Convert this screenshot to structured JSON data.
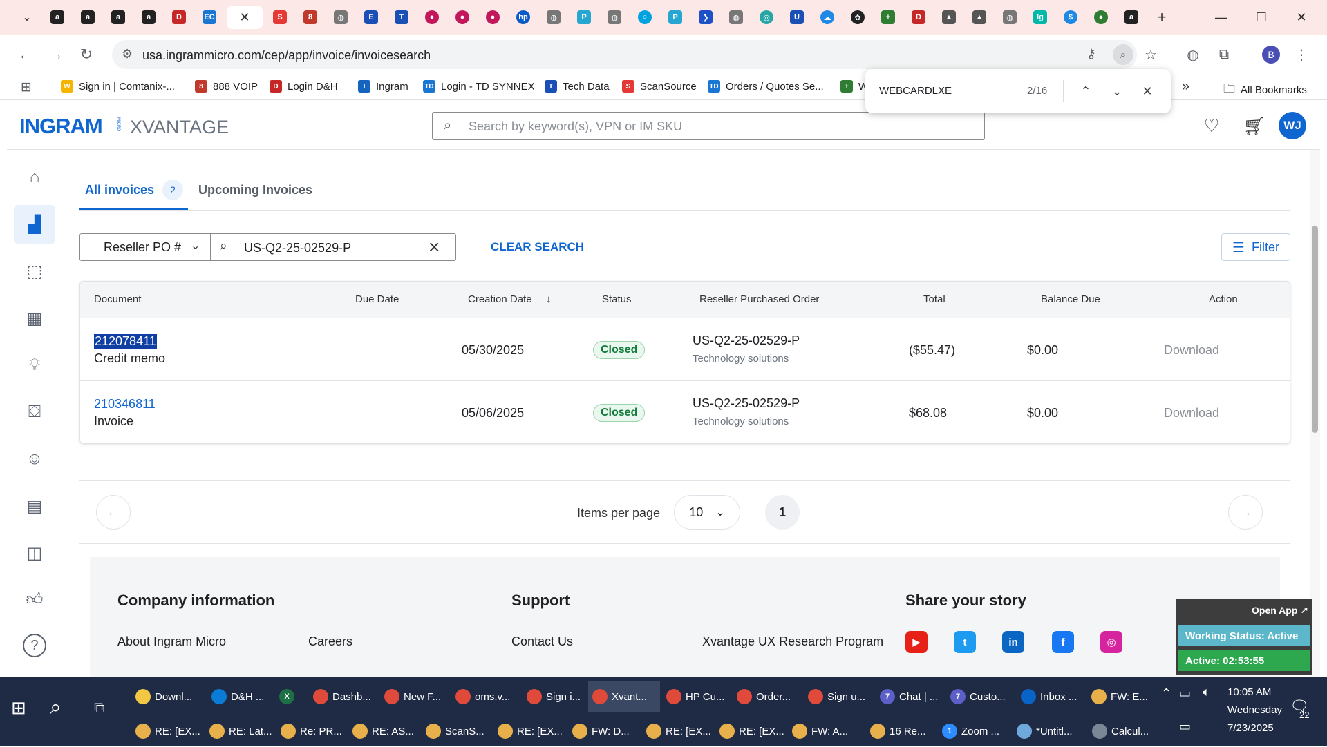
{
  "browser": {
    "url": "usa.ingrammicro.com/cep/app/invoice/invoicesearch",
    "bookmarks": [
      {
        "label": "Sign in | Comtanix-...",
        "color": "#f4b400",
        "glyph": "W"
      },
      {
        "label": "888 VOIP",
        "color": "#c0392b",
        "glyph": "8"
      },
      {
        "label": "Login D&H",
        "color": "#c62828",
        "glyph": "D"
      },
      {
        "label": "Ingram",
        "color": "#1565c0",
        "glyph": "I"
      },
      {
        "label": "Login - TD SYNNEX",
        "color": "#1976d2",
        "glyph": "TD"
      },
      {
        "label": "Tech Data",
        "color": "#1a4fb5",
        "glyph": "T"
      },
      {
        "label": "ScanSource",
        "color": "#e53935",
        "glyph": "S"
      },
      {
        "label": "Orders / Quotes Se...",
        "color": "#1976d2",
        "glyph": "TD"
      },
      {
        "label": "W",
        "color": "#2e7d32",
        "glyph": "+"
      }
    ],
    "all_bookmarks_label": "All Bookmarks",
    "profile_initial": "B"
  },
  "findbar": {
    "query": "WEBCARDLXE",
    "count": "2/16"
  },
  "site": {
    "logo_main": "INGRAM",
    "logo_micro": "MICRO",
    "logo_sub": "XVANTAGE",
    "search_placeholder": "Search by keyword(s), VPN or IM SKU",
    "avatar_initials": "WJ"
  },
  "tabs": {
    "all_label": "All invoices",
    "all_count": "2",
    "upcoming_label": "Upcoming Invoices"
  },
  "search": {
    "type_label": "Reseller PO #",
    "value": "US-Q2-25-02529-P",
    "clear_label": "CLEAR SEARCH",
    "filter_label": "Filter"
  },
  "table": {
    "headers": {
      "document": "Document",
      "due_date": "Due Date",
      "creation_date": "Creation Date",
      "status": "Status",
      "reseller_po": "Reseller Purchased Order",
      "total": "Total",
      "balance_due": "Balance Due",
      "action": "Action"
    },
    "rows": [
      {
        "doc": "212078411",
        "type": "Credit memo",
        "due": "",
        "created": "05/30/2025",
        "status": "Closed",
        "po": "US-Q2-25-02529-P",
        "po_sub": "Technology solutions",
        "total": "($55.47)",
        "balance": "$0.00",
        "action": "Download"
      },
      {
        "doc": "210346811",
        "type": "Invoice",
        "due": "",
        "created": "05/06/2025",
        "status": "Closed",
        "po": "US-Q2-25-02529-P",
        "po_sub": "Technology solutions",
        "total": "$68.08",
        "balance": "$0.00",
        "action": "Download"
      }
    ]
  },
  "pager": {
    "items_label": "Items per page",
    "items_value": "10",
    "current_page": "1"
  },
  "footer": {
    "company_heading": "Company information",
    "support_heading": "Support",
    "share_heading": "Share your story",
    "links": {
      "about": "About Ingram Micro",
      "careers": "Careers",
      "contact": "Contact Us",
      "research": "Xvantage UX Research Program"
    }
  },
  "widget": {
    "open_label": "Open App ↗",
    "working_status": "Working Status: Active",
    "active_timer": "Active: 02:53:55"
  },
  "taskbar": {
    "row1": [
      {
        "label": "Downl...",
        "color": "#f2c744"
      },
      {
        "label": "D&H ...",
        "color": "#0a7cd6"
      },
      {
        "label": "",
        "color": "#1d7044",
        "glyph": "X"
      },
      {
        "label": "Dashb...",
        "color": "#e04a3a"
      },
      {
        "label": "New F...",
        "color": "#e04a3a"
      },
      {
        "label": "oms.v...",
        "color": "#e04a3a"
      },
      {
        "label": "Sign i...",
        "color": "#e04a3a"
      },
      {
        "label": "Xvant...",
        "color": "#e04a3a"
      },
      {
        "label": "HP Cu...",
        "color": "#e04a3a"
      },
      {
        "label": "Order...",
        "color": "#e04a3a"
      },
      {
        "label": "Sign u...",
        "color": "#e04a3a"
      },
      {
        "label": "Chat | ...",
        "color": "#5b5fc7",
        "glyph": "7"
      },
      {
        "label": "Custo...",
        "color": "#5b5fc7",
        "glyph": "7"
      },
      {
        "label": "Inbox ...",
        "color": "#0a64c8"
      },
      {
        "label": "FW: E...",
        "color": "#e8b04a"
      }
    ],
    "row2": [
      {
        "label": "RE: [EX...",
        "color": "#e8b04a"
      },
      {
        "label": "RE: Lat...",
        "color": "#e8b04a"
      },
      {
        "label": "Re: PR...",
        "color": "#e8b04a"
      },
      {
        "label": "RE: AS...",
        "color": "#e8b04a"
      },
      {
        "label": "ScanS...",
        "color": "#e8b04a"
      },
      {
        "label": "RE: [EX...",
        "color": "#e8b04a"
      },
      {
        "label": "FW: D...",
        "color": "#e8b04a"
      },
      {
        "label": "RE: [EX...",
        "color": "#e8b04a"
      },
      {
        "label": "RE: [EX...",
        "color": "#e8b04a"
      },
      {
        "label": "FW: A...",
        "color": "#e8b04a"
      },
      {
        "label": "16 Re...",
        "color": "#e8b04a"
      },
      {
        "label": "Zoom ...",
        "color": "#2d8cff",
        "glyph": "1"
      },
      {
        "label": "*Untitl...",
        "color": "#6fa8dc"
      },
      {
        "label": "Calcul...",
        "color": "#7a8796"
      }
    ],
    "time": "10:05 AM",
    "day": "Wednesday",
    "date": "7/23/2025",
    "notification_count": "22"
  },
  "icons": {
    "left_nav": [
      "home-icon",
      "analytics-icon",
      "box-icon",
      "table-icon",
      "lightbulb-icon",
      "hand-box-icon",
      "support-person-icon",
      "calendar-icon",
      "bag-icon",
      "thumbs-up-icon",
      "help-icon"
    ]
  }
}
